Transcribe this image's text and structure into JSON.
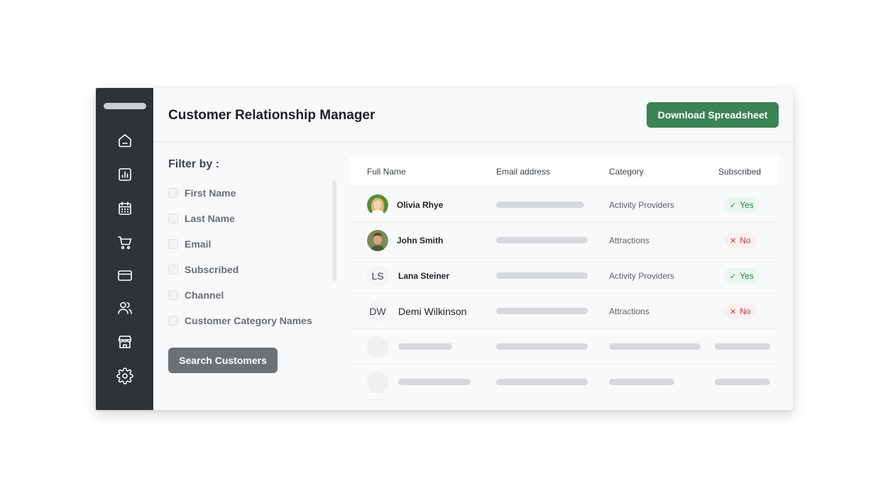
{
  "header": {
    "title": "Customer Relationship Manager",
    "download_label": "Download Spreadsheet"
  },
  "sidebar": {
    "icons": [
      "home-icon",
      "analytics-icon",
      "calendar-icon",
      "cart-icon",
      "credit-card-icon",
      "users-icon",
      "store-icon",
      "gear-icon"
    ]
  },
  "filters": {
    "title": "Filter by :",
    "items": [
      {
        "label": "First Name",
        "checked": false
      },
      {
        "label": "Last Name",
        "checked": false
      },
      {
        "label": "Email",
        "checked": false
      },
      {
        "label": "Subscribed",
        "checked": false
      },
      {
        "label": "Channel",
        "checked": false
      },
      {
        "label": "Customer Category Names",
        "checked": false
      }
    ],
    "search_label": "Search Customers"
  },
  "table": {
    "columns": [
      "Full Name",
      "Email address",
      "Category",
      "Subscribed"
    ],
    "rows": [
      {
        "avatar": "photo",
        "initials": "",
        "name": "Olivia Rhye",
        "category": "Activity Providers",
        "subscribed": "Yes"
      },
      {
        "avatar": "photo",
        "initials": "",
        "name": "John Smith",
        "category": "Attractions",
        "subscribed": "No"
      },
      {
        "avatar": "initials",
        "initials": "LS",
        "name": "Lana Steiner",
        "category": "Activity Providers",
        "subscribed": "Yes"
      },
      {
        "avatar": "initials",
        "initials": "DW",
        "name": "Demi Wilkinson",
        "category": "Attractions",
        "subscribed": "No"
      }
    ]
  },
  "colors": {
    "sidebar": "#2e3338",
    "primary_button": "#3b8255",
    "secondary_button": "#6c7176",
    "yes_badge": "#2e7a45",
    "no_badge": "#c23a3a"
  }
}
